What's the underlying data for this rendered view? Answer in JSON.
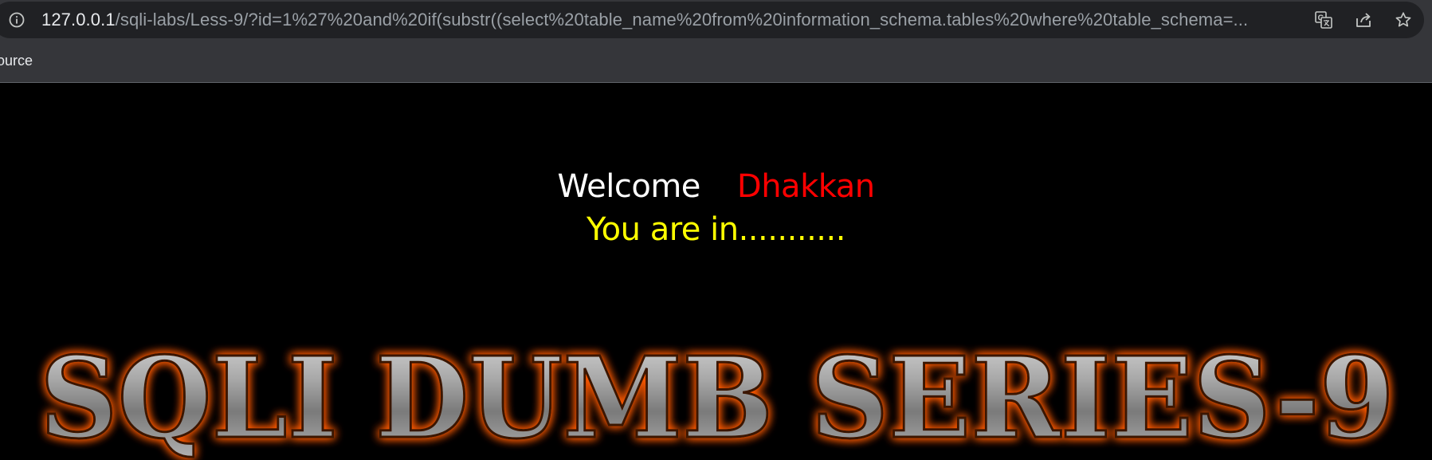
{
  "browser": {
    "url_host": "127.0.0.1",
    "url_path": "/sqli-labs/Less-9/?id=1%27%20and%20if(substr((select%20table_name%20from%20information_schema.tables%20where%20table_schema=...",
    "bookmark_label": "ource",
    "icons": {
      "info": "info-icon",
      "translate": "translate-icon",
      "share": "share-icon",
      "bookmark": "star-icon"
    }
  },
  "page": {
    "welcome_label": "Welcome",
    "user_name": "Dhakkan",
    "status_message": "You are in...........",
    "banner_text": "SQLI DUMB SERIES-9",
    "colors": {
      "welcome": "#ffffff",
      "name": "#ff0000",
      "status": "#ffff00",
      "banner_glow": "#ff6a00",
      "banner_metal": "#9a9a9a"
    }
  }
}
